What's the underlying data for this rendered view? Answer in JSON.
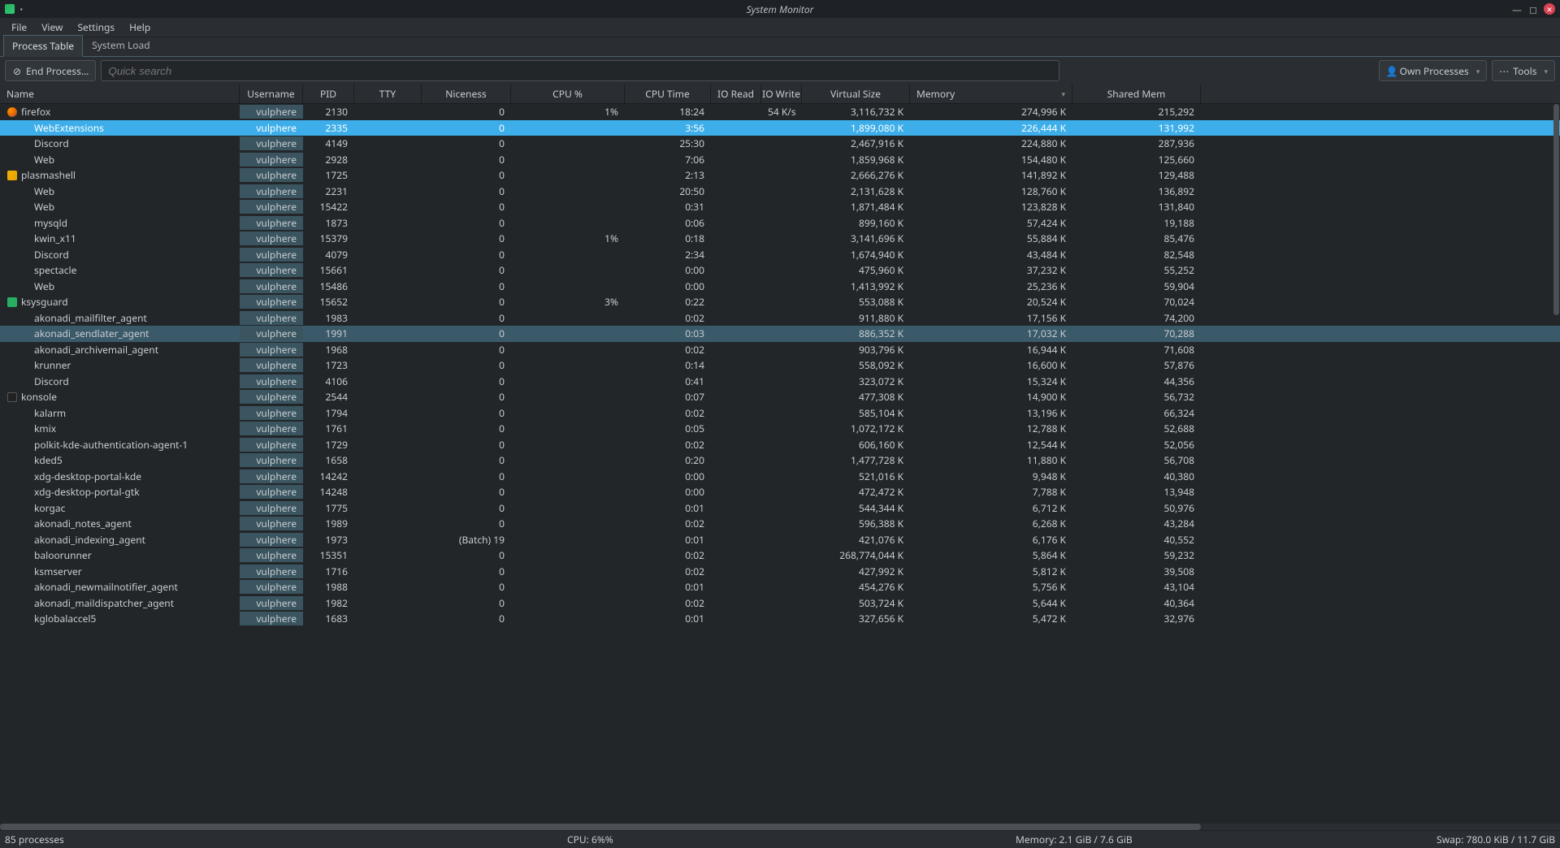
{
  "window": {
    "title": "System Monitor"
  },
  "menu": [
    "File",
    "View",
    "Settings",
    "Help"
  ],
  "tabs": [
    {
      "label": "Process Table",
      "active": true
    },
    {
      "label": "System Load",
      "active": false
    }
  ],
  "toolbar": {
    "end_process": "End Process…",
    "search_placeholder": "Quick search",
    "filter_label": "Own Processes",
    "tools_label": "Tools"
  },
  "columns": [
    "Name",
    "Username",
    "PID",
    "TTY",
    "Niceness",
    "CPU %",
    "CPU Time",
    "IO Read",
    "IO Write",
    "Virtual Size",
    "Memory",
    "Shared Mem"
  ],
  "sorted_column": "Memory",
  "processes": [
    {
      "icon": "firefox",
      "indent": 0,
      "name": "firefox",
      "user": "vulphere",
      "pid": "2130",
      "tty": "",
      "nice": "0",
      "cpu": "1%",
      "time": "18:24",
      "ioread": "",
      "iowrite": "54 K/s",
      "vsize": "3,116,732 K",
      "mem": "274,996 K",
      "shmem": "215,292"
    },
    {
      "icon": "generic",
      "indent": 1,
      "selected": true,
      "name": "WebExtensions",
      "user": "vulphere",
      "pid": "2335",
      "tty": "",
      "nice": "0",
      "cpu": "",
      "time": "3:56",
      "ioread": "",
      "iowrite": "",
      "vsize": "1,899,080 K",
      "mem": "226,444 K",
      "shmem": "131,992"
    },
    {
      "icon": "generic",
      "indent": 1,
      "name": "Discord",
      "user": "vulphere",
      "pid": "4149",
      "tty": "",
      "nice": "0",
      "cpu": "",
      "time": "25:30",
      "ioread": "",
      "iowrite": "",
      "vsize": "2,467,916 K",
      "mem": "224,880 K",
      "shmem": "287,936"
    },
    {
      "icon": "generic",
      "indent": 1,
      "name": "Web",
      "user": "vulphere",
      "pid": "2928",
      "tty": "",
      "nice": "0",
      "cpu": "",
      "time": "7:06",
      "ioread": "",
      "iowrite": "",
      "vsize": "1,859,968 K",
      "mem": "154,480 K",
      "shmem": "125,660"
    },
    {
      "icon": "plasma",
      "indent": 0,
      "name": "plasmashell",
      "user": "vulphere",
      "pid": "1725",
      "tty": "",
      "nice": "0",
      "cpu": "",
      "time": "2:13",
      "ioread": "",
      "iowrite": "",
      "vsize": "2,666,276 K",
      "mem": "141,892 K",
      "shmem": "129,488"
    },
    {
      "icon": "generic",
      "indent": 1,
      "name": "Web",
      "user": "vulphere",
      "pid": "2231",
      "tty": "",
      "nice": "0",
      "cpu": "",
      "time": "20:50",
      "ioread": "",
      "iowrite": "",
      "vsize": "2,131,628 K",
      "mem": "128,760 K",
      "shmem": "136,892"
    },
    {
      "icon": "generic",
      "indent": 1,
      "name": "Web",
      "user": "vulphere",
      "pid": "15422",
      "tty": "",
      "nice": "0",
      "cpu": "",
      "time": "0:31",
      "ioread": "",
      "iowrite": "",
      "vsize": "1,871,484 K",
      "mem": "123,828 K",
      "shmem": "131,840"
    },
    {
      "icon": "generic",
      "indent": 1,
      "name": "mysqld",
      "user": "vulphere",
      "pid": "1873",
      "tty": "",
      "nice": "0",
      "cpu": "",
      "time": "0:06",
      "ioread": "",
      "iowrite": "",
      "vsize": "899,160 K",
      "mem": "57,424 K",
      "shmem": "19,188"
    },
    {
      "icon": "generic",
      "indent": 1,
      "name": "kwin_x11",
      "user": "vulphere",
      "pid": "15379",
      "tty": "",
      "nice": "0",
      "cpu": "1%",
      "time": "0:18",
      "ioread": "",
      "iowrite": "",
      "vsize": "3,141,696 K",
      "mem": "55,884 K",
      "shmem": "85,476"
    },
    {
      "icon": "generic",
      "indent": 1,
      "name": "Discord",
      "user": "vulphere",
      "pid": "4079",
      "tty": "",
      "nice": "0",
      "cpu": "",
      "time": "2:34",
      "ioread": "",
      "iowrite": "",
      "vsize": "1,674,940 K",
      "mem": "43,484 K",
      "shmem": "82,548"
    },
    {
      "icon": "generic",
      "indent": 1,
      "name": "spectacle",
      "user": "vulphere",
      "pid": "15661",
      "tty": "",
      "nice": "0",
      "cpu": "",
      "time": "0:00",
      "ioread": "",
      "iowrite": "",
      "vsize": "475,960 K",
      "mem": "37,232 K",
      "shmem": "55,252"
    },
    {
      "icon": "generic",
      "indent": 1,
      "name": "Web",
      "user": "vulphere",
      "pid": "15486",
      "tty": "",
      "nice": "0",
      "cpu": "",
      "time": "0:00",
      "ioread": "",
      "iowrite": "",
      "vsize": "1,413,992 K",
      "mem": "25,236 K",
      "shmem": "59,904"
    },
    {
      "icon": "ksys",
      "indent": 0,
      "name": "ksysguard",
      "user": "vulphere",
      "pid": "15652",
      "tty": "",
      "nice": "0",
      "cpu": "3%",
      "time": "0:22",
      "ioread": "",
      "iowrite": "",
      "vsize": "553,088 K",
      "mem": "20,524 K",
      "shmem": "70,024"
    },
    {
      "icon": "generic",
      "indent": 1,
      "name": "akonadi_mailfilter_agent",
      "user": "vulphere",
      "pid": "1983",
      "tty": "",
      "nice": "0",
      "cpu": "",
      "time": "0:02",
      "ioread": "",
      "iowrite": "",
      "vsize": "911,880 K",
      "mem": "17,156 K",
      "shmem": "74,200"
    },
    {
      "icon": "generic",
      "indent": 1,
      "hovered": true,
      "name": "akonadi_sendlater_agent",
      "user": "vulphere",
      "pid": "1991",
      "tty": "",
      "nice": "0",
      "cpu": "",
      "time": "0:03",
      "ioread": "",
      "iowrite": "",
      "vsize": "886,352 K",
      "mem": "17,032 K",
      "shmem": "70,288"
    },
    {
      "icon": "generic",
      "indent": 1,
      "name": "akonadi_archivemail_agent",
      "user": "vulphere",
      "pid": "1968",
      "tty": "",
      "nice": "0",
      "cpu": "",
      "time": "0:02",
      "ioread": "",
      "iowrite": "",
      "vsize": "903,796 K",
      "mem": "16,944 K",
      "shmem": "71,608"
    },
    {
      "icon": "generic",
      "indent": 1,
      "name": "krunner",
      "user": "vulphere",
      "pid": "1723",
      "tty": "",
      "nice": "0",
      "cpu": "",
      "time": "0:14",
      "ioread": "",
      "iowrite": "",
      "vsize": "558,092 K",
      "mem": "16,600 K",
      "shmem": "57,876"
    },
    {
      "icon": "generic",
      "indent": 1,
      "name": "Discord",
      "user": "vulphere",
      "pid": "4106",
      "tty": "",
      "nice": "0",
      "cpu": "",
      "time": "0:41",
      "ioread": "",
      "iowrite": "",
      "vsize": "323,072 K",
      "mem": "15,324 K",
      "shmem": "44,356"
    },
    {
      "icon": "konsole",
      "indent": 0,
      "name": "konsole",
      "user": "vulphere",
      "pid": "2544",
      "tty": "",
      "nice": "0",
      "cpu": "",
      "time": "0:07",
      "ioread": "",
      "iowrite": "",
      "vsize": "477,308 K",
      "mem": "14,900 K",
      "shmem": "56,732"
    },
    {
      "icon": "generic",
      "indent": 1,
      "name": "kalarm",
      "user": "vulphere",
      "pid": "1794",
      "tty": "",
      "nice": "0",
      "cpu": "",
      "time": "0:02",
      "ioread": "",
      "iowrite": "",
      "vsize": "585,104 K",
      "mem": "13,196 K",
      "shmem": "66,324"
    },
    {
      "icon": "generic",
      "indent": 1,
      "name": "kmix",
      "user": "vulphere",
      "pid": "1761",
      "tty": "",
      "nice": "0",
      "cpu": "",
      "time": "0:05",
      "ioread": "",
      "iowrite": "",
      "vsize": "1,072,172 K",
      "mem": "12,788 K",
      "shmem": "52,688"
    },
    {
      "icon": "generic",
      "indent": 1,
      "name": "polkit-kde-authentication-agent-1",
      "user": "vulphere",
      "pid": "1729",
      "tty": "",
      "nice": "0",
      "cpu": "",
      "time": "0:02",
      "ioread": "",
      "iowrite": "",
      "vsize": "606,160 K",
      "mem": "12,544 K",
      "shmem": "52,056"
    },
    {
      "icon": "generic",
      "indent": 1,
      "name": "kded5",
      "user": "vulphere",
      "pid": "1658",
      "tty": "",
      "nice": "0",
      "cpu": "",
      "time": "0:20",
      "ioread": "",
      "iowrite": "",
      "vsize": "1,477,728 K",
      "mem": "11,880 K",
      "shmem": "56,708"
    },
    {
      "icon": "generic",
      "indent": 1,
      "name": "xdg-desktop-portal-kde",
      "user": "vulphere",
      "pid": "14242",
      "tty": "",
      "nice": "0",
      "cpu": "",
      "time": "0:00",
      "ioread": "",
      "iowrite": "",
      "vsize": "521,016 K",
      "mem": "9,948 K",
      "shmem": "40,380"
    },
    {
      "icon": "generic",
      "indent": 1,
      "name": "xdg-desktop-portal-gtk",
      "user": "vulphere",
      "pid": "14248",
      "tty": "",
      "nice": "0",
      "cpu": "",
      "time": "0:00",
      "ioread": "",
      "iowrite": "",
      "vsize": "472,472 K",
      "mem": "7,788 K",
      "shmem": "13,948"
    },
    {
      "icon": "generic",
      "indent": 1,
      "name": "korgac",
      "user": "vulphere",
      "pid": "1775",
      "tty": "",
      "nice": "0",
      "cpu": "",
      "time": "0:01",
      "ioread": "",
      "iowrite": "",
      "vsize": "544,344 K",
      "mem": "6,712 K",
      "shmem": "50,976"
    },
    {
      "icon": "generic",
      "indent": 1,
      "name": "akonadi_notes_agent",
      "user": "vulphere",
      "pid": "1989",
      "tty": "",
      "nice": "0",
      "cpu": "",
      "time": "0:02",
      "ioread": "",
      "iowrite": "",
      "vsize": "596,388 K",
      "mem": "6,268 K",
      "shmem": "43,284"
    },
    {
      "icon": "generic",
      "indent": 1,
      "name": "akonadi_indexing_agent",
      "user": "vulphere",
      "pid": "1973",
      "tty": "",
      "nice": "(Batch) 19",
      "cpu": "",
      "time": "0:01",
      "ioread": "",
      "iowrite": "",
      "vsize": "421,076 K",
      "mem": "6,176 K",
      "shmem": "40,552"
    },
    {
      "icon": "generic",
      "indent": 1,
      "name": "baloorunner",
      "user": "vulphere",
      "pid": "15351",
      "tty": "",
      "nice": "0",
      "cpu": "",
      "time": "0:02",
      "ioread": "",
      "iowrite": "",
      "vsize": "268,774,044 K",
      "mem": "5,864 K",
      "shmem": "59,232"
    },
    {
      "icon": "generic",
      "indent": 1,
      "name": "ksmserver",
      "user": "vulphere",
      "pid": "1716",
      "tty": "",
      "nice": "0",
      "cpu": "",
      "time": "0:02",
      "ioread": "",
      "iowrite": "",
      "vsize": "427,992 K",
      "mem": "5,812 K",
      "shmem": "39,508"
    },
    {
      "icon": "generic",
      "indent": 1,
      "name": "akonadi_newmailnotifier_agent",
      "user": "vulphere",
      "pid": "1988",
      "tty": "",
      "nice": "0",
      "cpu": "",
      "time": "0:01",
      "ioread": "",
      "iowrite": "",
      "vsize": "454,276 K",
      "mem": "5,756 K",
      "shmem": "43,104"
    },
    {
      "icon": "generic",
      "indent": 1,
      "name": "akonadi_maildispatcher_agent",
      "user": "vulphere",
      "pid": "1982",
      "tty": "",
      "nice": "0",
      "cpu": "",
      "time": "0:02",
      "ioread": "",
      "iowrite": "",
      "vsize": "503,724 K",
      "mem": "5,644 K",
      "shmem": "40,364"
    },
    {
      "icon": "generic",
      "indent": 1,
      "name": "kglobalaccel5",
      "user": "vulphere",
      "pid": "1683",
      "tty": "",
      "nice": "0",
      "cpu": "",
      "time": "0:01",
      "ioread": "",
      "iowrite": "",
      "vsize": "327,656 K",
      "mem": "5,472 K",
      "shmem": "32,976"
    }
  ],
  "status": {
    "count": "85 processes",
    "cpu": "CPU: 6%%",
    "mem": "Memory: 2.1 GiB / 7.6 GiB",
    "swap": "Swap: 780.0 KiB / 11.7 GiB"
  }
}
